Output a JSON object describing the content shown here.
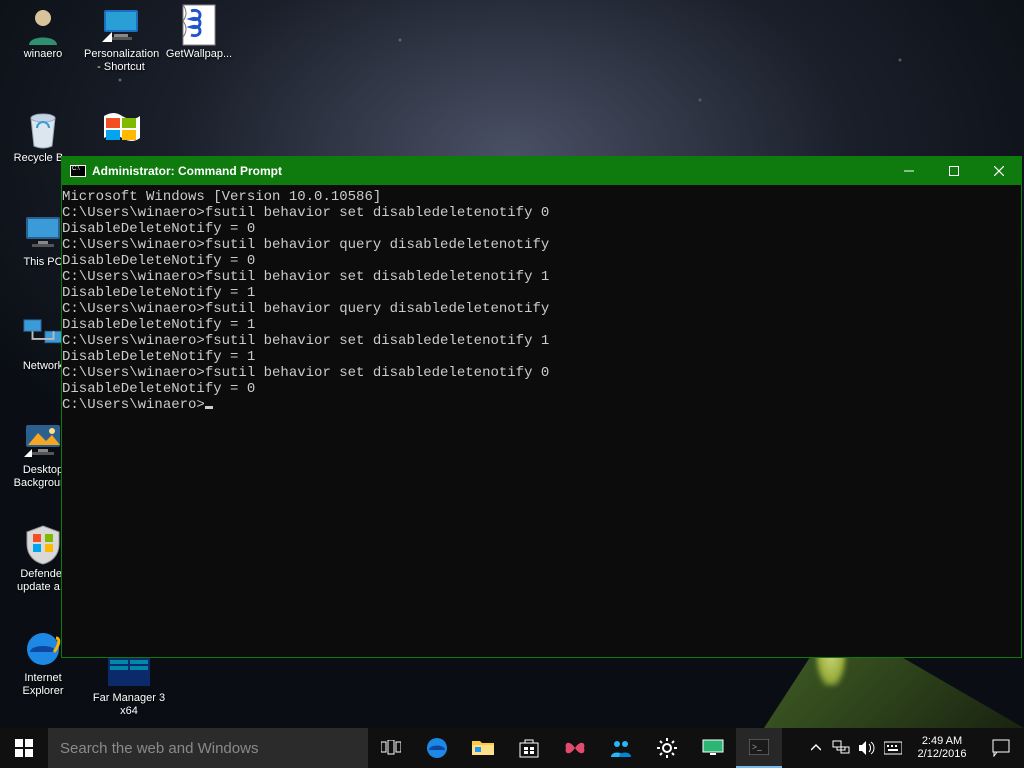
{
  "desktop_icons": [
    {
      "id": "winaero",
      "label": "winaero"
    },
    {
      "id": "personalization",
      "label": "Personalization\n- Shortcut"
    },
    {
      "id": "getwallpaper",
      "label": "GetWallpap..."
    },
    {
      "id": "recyclebin",
      "label": "Recycle B..."
    },
    {
      "id": "thispc",
      "label": "This PC"
    },
    {
      "id": "network",
      "label": "Network"
    },
    {
      "id": "desktopbg",
      "label": "Desktop\nBackground"
    },
    {
      "id": "defender",
      "label": "Defender\nupdate a..."
    },
    {
      "id": "ie",
      "label": "Internet\nExplorer"
    },
    {
      "id": "farmanager",
      "label": "Far Manager 3\nx64"
    }
  ],
  "cmd": {
    "title": "Administrator: Command Prompt",
    "lines": [
      "Microsoft Windows [Version 10.0.10586]",
      "",
      "C:\\Users\\winaero>fsutil behavior set disabledeletenotify 0",
      "DisableDeleteNotify = 0",
      "",
      "C:\\Users\\winaero>fsutil behavior query disabledeletenotify",
      "DisableDeleteNotify = 0",
      "",
      "C:\\Users\\winaero>fsutil behavior set disabledeletenotify 1",
      "DisableDeleteNotify = 1",
      "",
      "C:\\Users\\winaero>fsutil behavior query disabledeletenotify",
      "DisableDeleteNotify = 1",
      "",
      "C:\\Users\\winaero>fsutil behavior set disabledeletenotify 1",
      "DisableDeleteNotify = 1",
      "",
      "C:\\Users\\winaero>fsutil behavior set disabledeletenotify 0",
      "DisableDeleteNotify = 0",
      "",
      "C:\\Users\\winaero>"
    ]
  },
  "taskbar": {
    "search_placeholder": "Search the web and Windows",
    "time": "2:49 AM",
    "date": "2/12/2016"
  }
}
